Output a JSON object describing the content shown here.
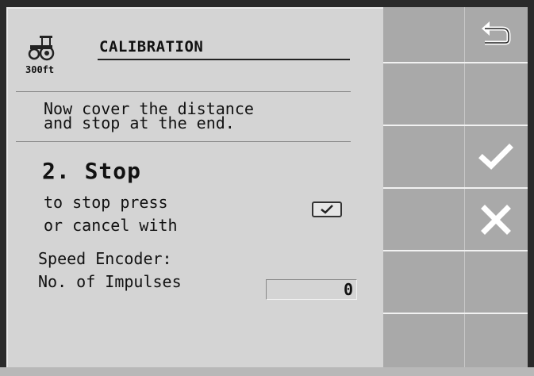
{
  "header": {
    "tractor_badge": "300ft",
    "title": "CALIBRATION"
  },
  "instruction": {
    "line1": "Now cover the distance",
    "line2": "and stop at the end."
  },
  "step": {
    "label": "2. Stop",
    "stop_text": "to stop press",
    "cancel_text": "or cancel with"
  },
  "encoder": {
    "heading": "Speed Encoder:",
    "impulses_label": "No. of Impulses",
    "impulses_value": "0"
  },
  "softkeys": [
    {
      "icon": "return-icon"
    },
    {
      "icon": "blank"
    },
    {
      "icon": "check-icon"
    },
    {
      "icon": "cross-icon"
    },
    {
      "icon": "blank"
    },
    {
      "icon": "blank"
    }
  ]
}
